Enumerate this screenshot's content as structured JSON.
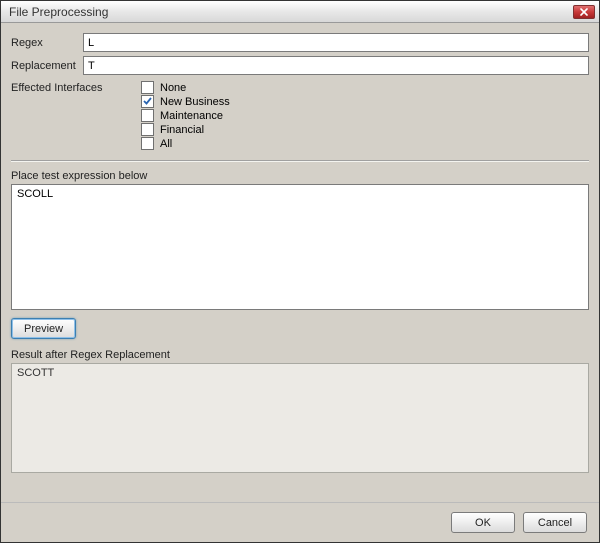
{
  "window": {
    "title": "File Preprocessing"
  },
  "fields": {
    "regex_label": "Regex",
    "regex_value": "L",
    "replacement_label": "Replacement",
    "replacement_value": "T"
  },
  "interfaces": {
    "label": "Effected Interfaces",
    "items": [
      {
        "label": "None",
        "checked": false
      },
      {
        "label": "New Business",
        "checked": true
      },
      {
        "label": "Maintenance",
        "checked": false
      },
      {
        "label": "Financial",
        "checked": false
      },
      {
        "label": "All",
        "checked": false
      }
    ]
  },
  "test": {
    "label": "Place test expression below",
    "value": "SCOLL"
  },
  "buttons": {
    "preview": "Preview",
    "ok": "OK",
    "cancel": "Cancel"
  },
  "result": {
    "label": "Result after Regex Replacement",
    "value": "SCOTT"
  }
}
